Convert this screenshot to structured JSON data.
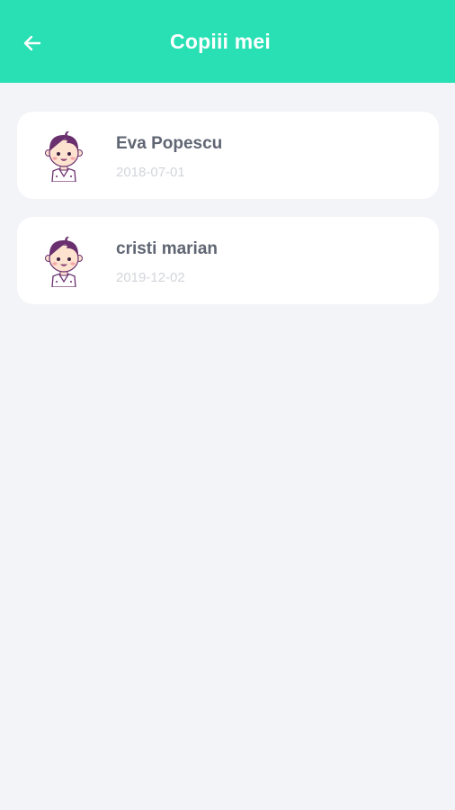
{
  "header": {
    "title": "Copiii mei",
    "back_icon": "arrow-left-icon",
    "background": "#29e0b4"
  },
  "children": [
    {
      "name": "Eva Popescu",
      "birthdate": "2018-07-01",
      "avatar_icon": "child-avatar-icon"
    },
    {
      "name": "cristi marian",
      "birthdate": "2019-12-02",
      "avatar_icon": "child-avatar-icon"
    }
  ],
  "colors": {
    "accent": "#29e0b4",
    "background": "#f2f4f8",
    "avatar_hair": "#6a2f6e"
  }
}
